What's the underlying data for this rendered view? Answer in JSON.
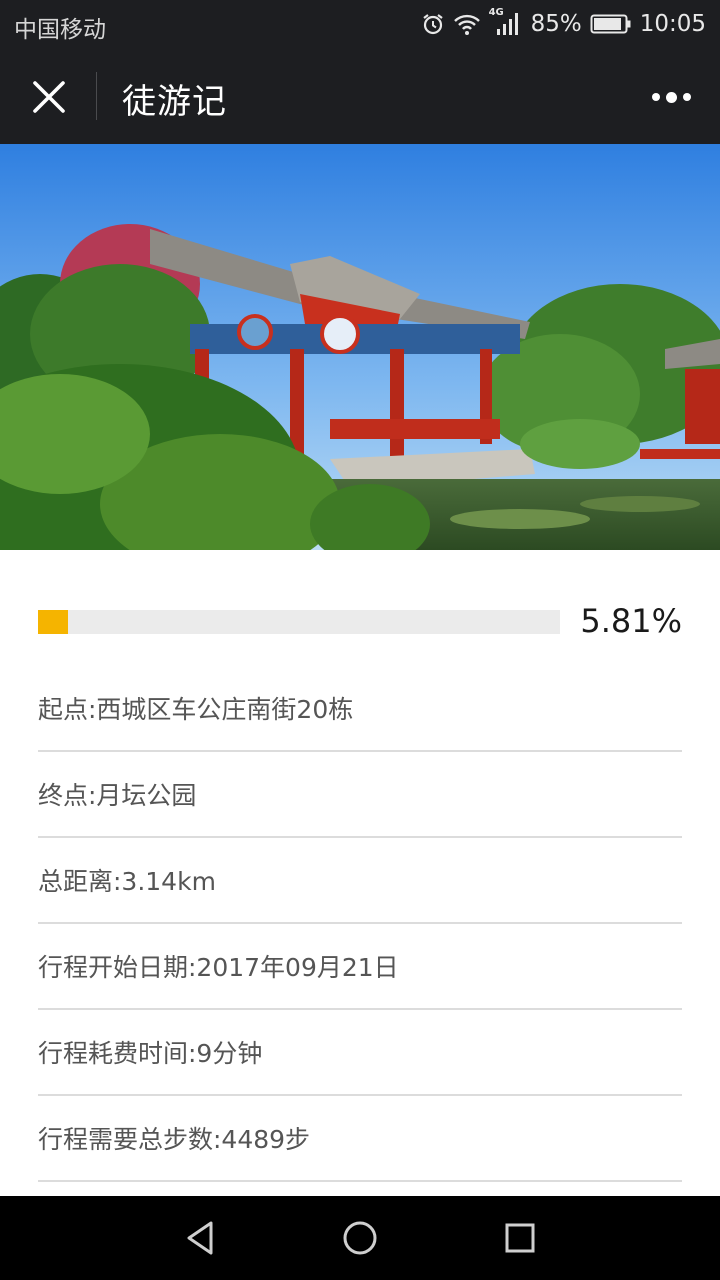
{
  "status_bar": {
    "carrier": "中国移动",
    "network": "4G",
    "battery": "85%",
    "time": "10:05",
    "icons": [
      "alarm-icon",
      "wifi-icon",
      "signal-icon",
      "battery-icon"
    ]
  },
  "title_bar": {
    "title": "徒游记",
    "close_icon": "close-icon",
    "more_icon": "more-icon"
  },
  "hero": {
    "image": "chinese-pavilion-garden-photo"
  },
  "progress": {
    "value": 0.0581,
    "label": "5.81%",
    "fill_color": "#f5b400",
    "track_color": "#ebebeb"
  },
  "info": {
    "start": "起点:西城区车公庄南街20栋",
    "end": "终点:月坛公园",
    "distance": "总距离:3.14km",
    "start_date": "行程开始日期:2017年09月21日",
    "time_spent": "行程耗费时间:9分钟",
    "total_steps": "行程需要总步数:4489步"
  },
  "nav_bar": {
    "buttons": [
      "back-icon",
      "home-icon",
      "recents-icon"
    ]
  }
}
